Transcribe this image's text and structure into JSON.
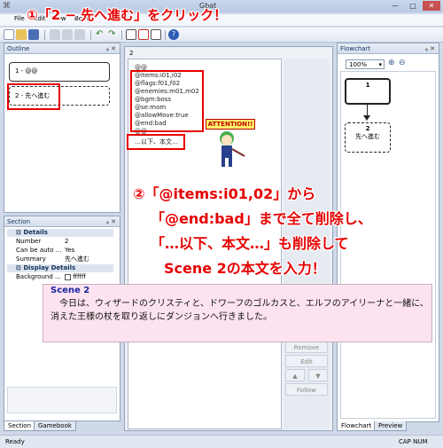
{
  "window": {
    "title": "Gbat"
  },
  "menu": [
    "File",
    "Edit",
    "View",
    "Book"
  ],
  "annotations": {
    "step1": "①「2 − 先へ進む」をクリック！",
    "step2_line1": "②「@items:i01,02」から",
    "step2_line2": "「@end:bad」まで全て削除し、",
    "step2_line3": "「…以下、本文…」も削除して",
    "step2_line4": "Scene 2の本文を入力！",
    "attention": "ATTENTION!!"
  },
  "outline": {
    "header": "Outline",
    "items": [
      {
        "label": "1 - @@"
      },
      {
        "label": "2 - 先へ進む"
      }
    ]
  },
  "section": {
    "header": "Section",
    "details_header": "Details",
    "props": [
      {
        "k": "Number",
        "v": "2"
      },
      {
        "k": "Can be auto ...",
        "v": "Yes"
      },
      {
        "k": "Summary",
        "v": "先へ進む"
      }
    ],
    "display_header": "Display Details",
    "bg_key": "Background ...",
    "bg_val": "ffffff"
  },
  "editor": {
    "number": "2",
    "lines": [
      "@@",
      "@items:i01,i02",
      "@flags:f01,f02",
      "@enemies:m01,m02",
      "@bgm:boss",
      "@se:mom",
      "@allowMove:true",
      "@end:bad",
      "@@",
      "…以下、本文…"
    ]
  },
  "scene2": {
    "title": "Scene 2",
    "body": "　今日は、ウィザードのクリスティと、ドワーフのゴルカスと、エルフのアイリーナと一緒に、消えた王様の杖を取り返しにダンジョンへ行きました。"
  },
  "side_buttons": [
    "Remove",
    "Edit",
    "▲",
    "▼",
    "Follow"
  ],
  "flowchart": {
    "header": "Flowchart",
    "zoom": "100%",
    "node1": "1",
    "node2_num": "2",
    "node2_label": "先へ進む"
  },
  "tabs": {
    "left": [
      "Section",
      "Gamebook"
    ],
    "right": [
      "Flowchart",
      "Preview"
    ]
  },
  "status": {
    "left": "Ready",
    "right": "CAP  NUM"
  }
}
